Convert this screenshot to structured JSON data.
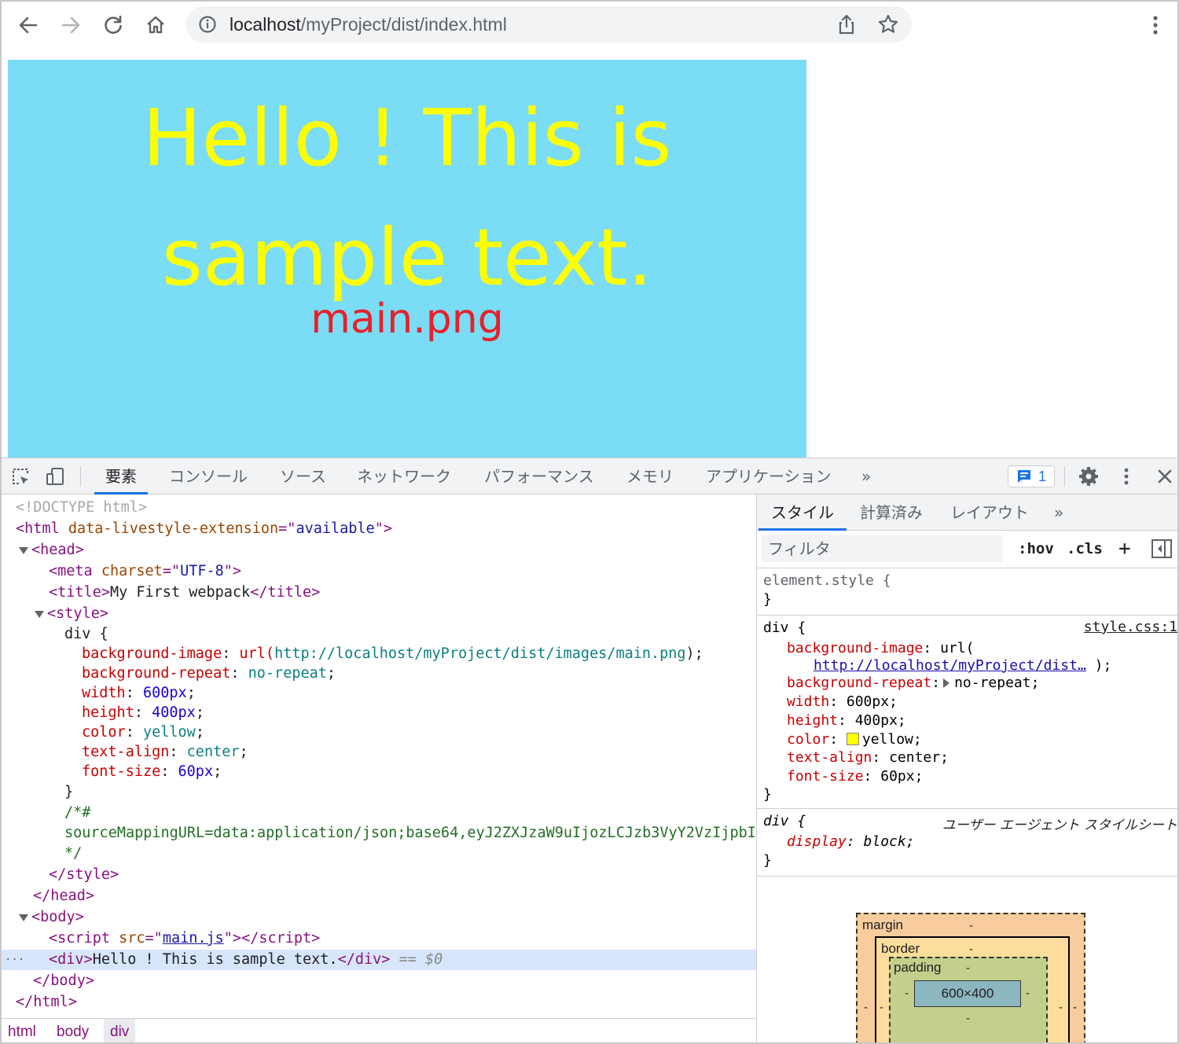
{
  "browser": {
    "url_host": "localhost",
    "url_path": "/myProject/dist/index.html"
  },
  "page": {
    "div_text_line1": "Hello ! This is",
    "div_text_line2": "sample text.",
    "background_image_label": "main.png",
    "colors": {
      "div_background": "#7adcf5",
      "div_text": "#ffff00",
      "image_label": "#e8202a"
    }
  },
  "devtools": {
    "tabs": [
      "要素",
      "コンソール",
      "ソース",
      "ネットワーク",
      "パフォーマンス",
      "メモリ",
      "アプリケーション"
    ],
    "more_tabs": "»",
    "issues_count": "1",
    "elements": {
      "doctype": "<!DOCTYPE html>",
      "html_open_tag": "html",
      "html_attr_name": "data-livestyle-extension",
      "html_attr_value": "available",
      "head": "head",
      "meta_tag": "meta",
      "meta_attr": "charset",
      "meta_value": "UTF-8",
      "title_tag": "title",
      "title_text": "My First webpack",
      "style_tag": "style",
      "css_selector": "div {",
      "css_rules": [
        {
          "prop": "background-image",
          "value_prefix": "url(",
          "value": "http://localhost/myProject/dist/images/main.png",
          "value_suffix": ");"
        },
        {
          "prop": "background-repeat",
          "value": "no-repeat",
          "value_suffix": ";"
        },
        {
          "prop": "width",
          "value": "600px",
          "value_suffix": ";"
        },
        {
          "prop": "height",
          "value": "400px",
          "value_suffix": ";"
        },
        {
          "prop": "color",
          "value": "yellow",
          "value_suffix": ";"
        },
        {
          "prop": "text-align",
          "value": "center",
          "value_suffix": ";"
        },
        {
          "prop": "font-size",
          "value": "60px",
          "value_suffix": ";"
        }
      ],
      "css_close": "}",
      "comment_open": "/*#",
      "comment_body": "sourceMappingURL=data:application/json;base64,eyJ2ZXJzaW9uIjozLCJzb3VyY2VzIjpbI",
      "comment_close": "*/",
      "body": "body",
      "script_tag": "script",
      "script_attr": "src",
      "script_src": "main.js",
      "div_tag": "div",
      "div_text": "Hello ! This is sample text.",
      "selected_marker": "== $0"
    },
    "breadcrumbs": [
      "html",
      "body",
      "div"
    ],
    "styles_pane": {
      "tabs": [
        "スタイル",
        "計算済み",
        "レイアウト"
      ],
      "more": "»",
      "filter_placeholder": "フィルタ",
      "hov": ":hov",
      "cls": ".cls",
      "plus": "+",
      "element_style": "element.style {",
      "close_brace": "}",
      "rule_selector": "div {",
      "rule_source": "style.css:1",
      "rule_props": [
        {
          "prop": "background-image",
          "value": "url("
        },
        {
          "prop": "background-repeat",
          "value": "no-repeat;"
        },
        {
          "prop": "width",
          "value": "600px;"
        },
        {
          "prop": "height",
          "value": "400px;"
        },
        {
          "prop": "color",
          "value": "yellow;"
        },
        {
          "prop": "text-align",
          "value": "center;"
        },
        {
          "prop": "font-size",
          "value": "60px;"
        }
      ],
      "bg_url_link": "http://localhost/myProject/dist…",
      "bg_url_suffix": ");",
      "ua_selector": "div {",
      "ua_label": "ユーザー エージェント スタイルシート",
      "ua_prop": "display",
      "ua_value": "block;",
      "box_model": {
        "margin": "margin",
        "border": "border",
        "padding": "padding",
        "content": "600×400",
        "dash": "-"
      }
    }
  }
}
